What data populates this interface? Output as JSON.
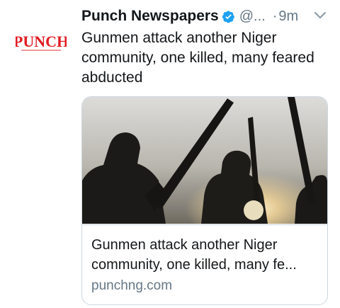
{
  "account": {
    "display_name": "Punch Newspapers",
    "handle": "@...",
    "dot": "·",
    "time": "9m",
    "logo_text": "PUNCH",
    "verified_icon": "verified-badge-icon",
    "caret_icon": "chevron-down-icon"
  },
  "tweet": {
    "text": "Gunmen attack another Niger community, one killed, many feared abducted"
  },
  "card": {
    "title": "Gunmen attack another Niger community, one killed, many fe...",
    "domain": "punchng.com"
  },
  "colors": {
    "brand_red": "#e11b22",
    "verified_blue": "#1da1f2",
    "secondary_text": "#657786",
    "border": "#ccd6dd"
  }
}
